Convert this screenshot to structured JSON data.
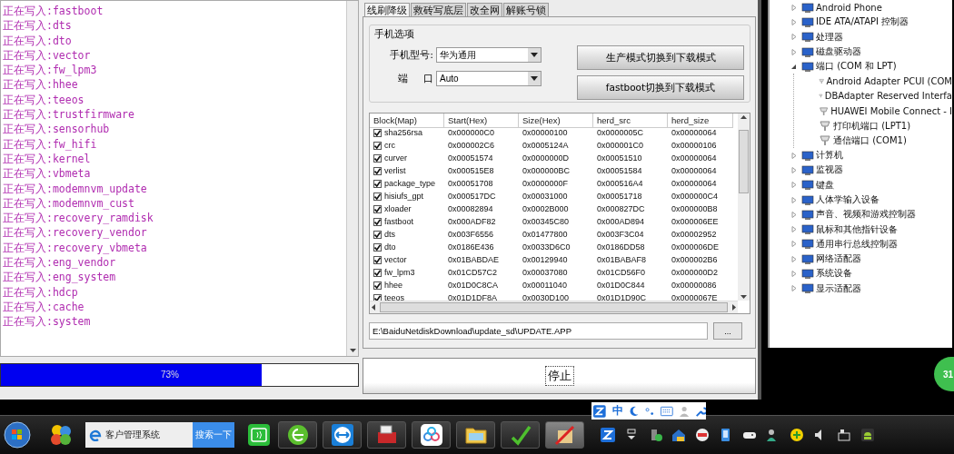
{
  "log": {
    "lines": [
      "正在写入:fastboot",
      "正在写入:dts",
      "正在写入:dto",
      "正在写入:vector",
      "正在写入:fw_lpm3",
      "正在写入:hhee",
      "正在写入:teeos",
      "正在写入:trustfirmware",
      "正在写入:sensorhub",
      "正在写入:fw_hifi",
      "正在写入:kernel",
      "正在写入:vbmeta",
      "正在写入:modemnvm_update",
      "正在写入:modemnvm_cust",
      "正在写入:recovery_ramdisk",
      "正在写入:recovery_vendor",
      "正在写入:recovery_vbmeta",
      "正在写入:eng_vendor",
      "正在写入:eng_system",
      "正在写入:hdcp",
      "正在写入:cache",
      "正在写入:system"
    ]
  },
  "progress": {
    "level": 0.73,
    "label": "73%"
  },
  "tabs": [
    {
      "label": "线刷降级",
      "selected": true
    },
    {
      "label": "救砖写底层",
      "selected": false
    },
    {
      "label": "改全网",
      "selected": false
    },
    {
      "label": "解账号锁",
      "selected": false
    }
  ],
  "phone_options": {
    "title": "手机选项",
    "model_label": "手机型号:",
    "model_value": "华为通用",
    "port_label": "端 口",
    "port_value": "Auto",
    "buttons": [
      "生产模式切换到下载模式",
      "fastboot切换到下载模式"
    ]
  },
  "table": {
    "columns": [
      "Block(Map)",
      "Start(Hex)",
      "Size(Hex)",
      "herd_src",
      "herd_size"
    ],
    "rows": [
      {
        "checked": true,
        "cells": [
          "sha256rsa",
          "0x000000C0",
          "0x00000100",
          "0x0000005C",
          "0x00000064"
        ]
      },
      {
        "checked": true,
        "cells": [
          "crc",
          "0x000002C6",
          "0x0005124A",
          "0x000001C0",
          "0x00000106"
        ]
      },
      {
        "checked": true,
        "cells": [
          "curver",
          "0x00051574",
          "0x0000000D",
          "0x00051510",
          "0x00000064"
        ]
      },
      {
        "checked": true,
        "cells": [
          "verlist",
          "0x000515E8",
          "0x000000BC",
          "0x00051584",
          "0x00000064"
        ]
      },
      {
        "checked": true,
        "cells": [
          "package_type",
          "0x00051708",
          "0x0000000F",
          "0x000516A4",
          "0x00000064"
        ]
      },
      {
        "checked": true,
        "cells": [
          "hisiufs_gpt",
          "0x000517DC",
          "0x00031000",
          "0x00051718",
          "0x000000C4"
        ]
      },
      {
        "checked": true,
        "cells": [
          "xloader",
          "0x00082894",
          "0x0002B000",
          "0x000827DC",
          "0x000000B8"
        ]
      },
      {
        "checked": true,
        "cells": [
          "fastboot",
          "0x000ADF82",
          "0x00345C80",
          "0x000AD894",
          "0x000006EE"
        ]
      },
      {
        "checked": true,
        "cells": [
          "dts",
          "0x003F6556",
          "0x01477800",
          "0x003F3C04",
          "0x00002952"
        ]
      },
      {
        "checked": true,
        "cells": [
          "dto",
          "0x0186E436",
          "0x0033D6C0",
          "0x0186DD58",
          "0x000006DE"
        ]
      },
      {
        "checked": true,
        "cells": [
          "vector",
          "0x01BABDAE",
          "0x00129940",
          "0x01BABAF8",
          "0x000002B6"
        ]
      },
      {
        "checked": true,
        "cells": [
          "fw_lpm3",
          "0x01CD57C2",
          "0x00037080",
          "0x01CD56F0",
          "0x000000D2"
        ]
      },
      {
        "checked": true,
        "cells": [
          "hhee",
          "0x01D0C8CA",
          "0x00011040",
          "0x01D0C844",
          "0x00000086"
        ]
      },
      {
        "checked": true,
        "cells": [
          "teeos",
          "0x01D1DF8A",
          "0x0030D100",
          "0x01D1D90C",
          "0x0000067E"
        ]
      }
    ]
  },
  "file_path": {
    "value": "E:\\BaiduNetdiskDownload\\update_sd\\UPDATE.APP",
    "browse_button": "..."
  },
  "stop_button": "停止",
  "device_tree": {
    "items": [
      {
        "label": "Android Phone",
        "expanded": false
      },
      {
        "label": "IDE ATA/ATAPI 控制器",
        "expanded": false
      },
      {
        "label": "处理器",
        "expanded": false
      },
      {
        "label": "磁盘驱动器",
        "expanded": false
      },
      {
        "label": "端口 (COM 和 LPT)",
        "expanded": true,
        "children": [
          {
            "label": "Android Adapter PCUI (COM"
          },
          {
            "label": "DBAdapter Reserved Interfa"
          },
          {
            "label": "HUAWEI Mobile Connect - I"
          },
          {
            "label": "打印机端口 (LPT1)"
          },
          {
            "label": "通信端口 (COM1)"
          }
        ]
      },
      {
        "label": "计算机",
        "expanded": false
      },
      {
        "label": "监视器",
        "expanded": false
      },
      {
        "label": "键盘",
        "expanded": false
      },
      {
        "label": "人体学输入设备",
        "expanded": false
      },
      {
        "label": "声音、视频和游戏控制器",
        "expanded": false
      },
      {
        "label": "鼠标和其他指针设备",
        "expanded": false
      },
      {
        "label": "通用串行总线控制器",
        "expanded": false
      },
      {
        "label": "网络适配器",
        "expanded": false
      },
      {
        "label": "系统设备",
        "expanded": false
      },
      {
        "label": "显示适配器",
        "expanded": false
      }
    ]
  },
  "floating_widget": {
    "text": "31"
  },
  "ime_bar": {
    "mode": "中"
  },
  "taskbar": {
    "search_box": {
      "value": "客户管理系统",
      "button": "搜索一下"
    }
  }
}
